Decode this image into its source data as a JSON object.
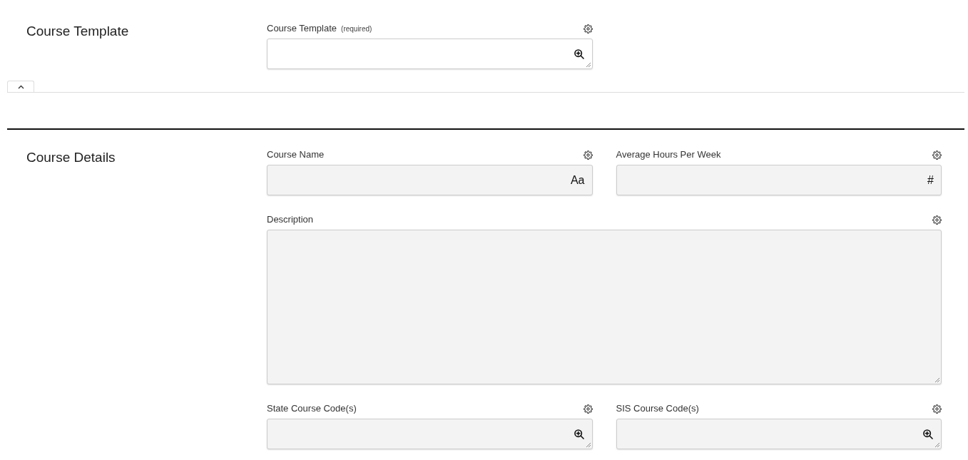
{
  "sections": [
    {
      "title": "Course Template",
      "expanded": true,
      "fields": [
        {
          "label": "Course Template",
          "note": "(required)",
          "full_width": false,
          "kind": "lookup",
          "disabled": false
        }
      ]
    },
    {
      "title": "Course Details",
      "fields": [
        {
          "label": "Course Name",
          "full_width": false,
          "kind": "text",
          "adornment": "Aa",
          "disabled": true
        },
        {
          "label": "Average Hours Per Week",
          "full_width": false,
          "kind": "number",
          "adornment": "#",
          "disabled": true
        },
        {
          "label": "Description",
          "full_width": true,
          "kind": "textarea",
          "disabled": true
        },
        {
          "label": "State Course Code(s)",
          "full_width": false,
          "kind": "lookup",
          "disabled": true
        },
        {
          "label": "SIS Course Code(s)",
          "full_width": false,
          "kind": "lookup",
          "disabled": true
        }
      ]
    }
  ]
}
